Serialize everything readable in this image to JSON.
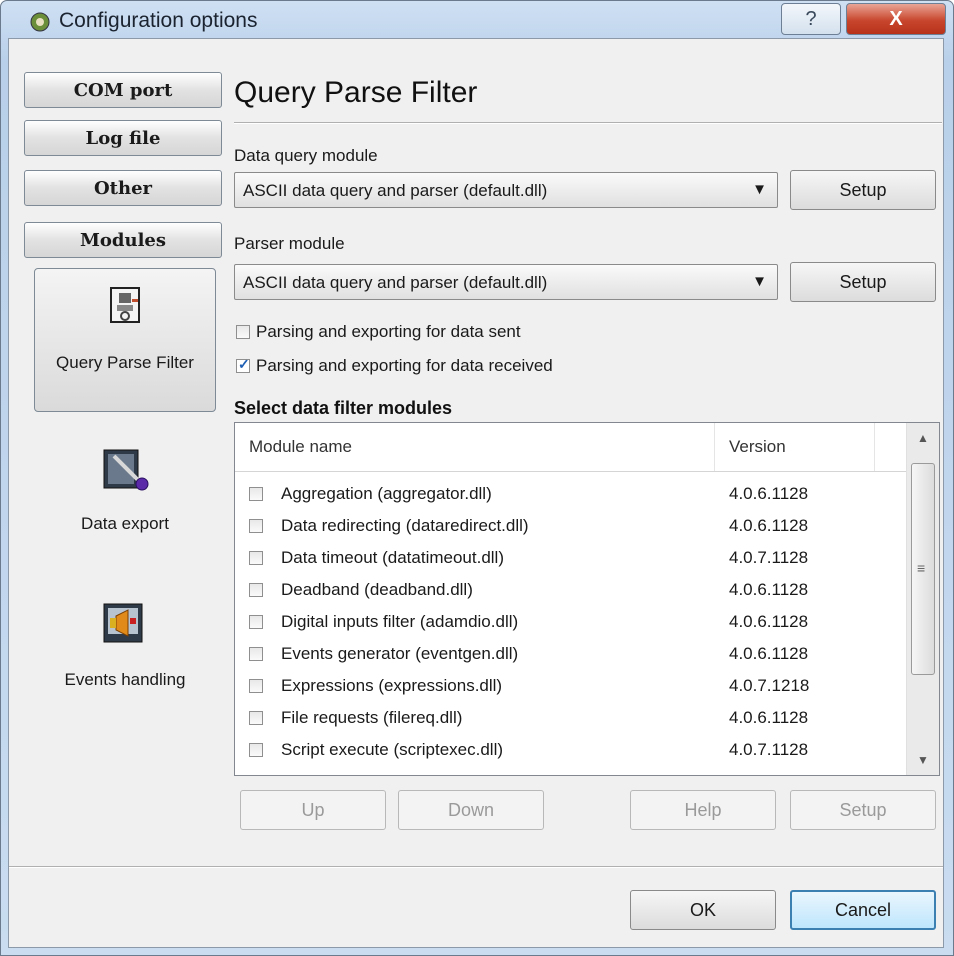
{
  "window": {
    "title": "Configuration options",
    "help_label": "?",
    "close_label": "X"
  },
  "nav_tabs": [
    {
      "label": "COM port"
    },
    {
      "label": "Log file"
    },
    {
      "label": "Other"
    },
    {
      "label": "Modules"
    }
  ],
  "modules_panel": [
    {
      "label": "Query Parse Filter",
      "icon": "plugin-icon",
      "selected": true
    },
    {
      "label": "Data export",
      "icon": "data-export-icon"
    },
    {
      "label": "Events handling",
      "icon": "events-icon"
    }
  ],
  "page": {
    "heading": "Query Parse Filter",
    "data_query_label": "Data query module",
    "data_query_value": "ASCII data query and parser (default.dll)",
    "parser_label": "Parser module",
    "parser_value": "ASCII data query and parser (default.dll)",
    "setup_label": "Setup",
    "check_sent": {
      "label": "Parsing and exporting for data sent",
      "checked": false
    },
    "check_received": {
      "label": "Parsing and exporting for data received",
      "checked": true
    },
    "filter_section": "Select data filter modules"
  },
  "filter_list": {
    "columns": [
      "Module name",
      "Version"
    ],
    "rows": [
      {
        "name": "Aggregation (aggregator.dll)",
        "version": "4.0.6.1128"
      },
      {
        "name": "Data redirecting (dataredirect.dll)",
        "version": "4.0.6.1128"
      },
      {
        "name": "Data timeout (datatimeout.dll)",
        "version": "4.0.7.1128"
      },
      {
        "name": "Deadband (deadband.dll)",
        "version": "4.0.6.1128"
      },
      {
        "name": "Digital inputs filter (adamdio.dll)",
        "version": "4.0.6.1128"
      },
      {
        "name": "Events generator (eventgen.dll)",
        "version": "4.0.6.1128"
      },
      {
        "name": "Expressions (expressions.dll)",
        "version": "4.0.7.1218"
      },
      {
        "name": "File requests (filereq.dll)",
        "version": "4.0.6.1128"
      },
      {
        "name": "Script execute (scriptexec.dll)",
        "version": "4.0.7.1128"
      }
    ]
  },
  "list_buttons": {
    "up": "Up",
    "down": "Down",
    "help": "Help",
    "setup": "Setup"
  },
  "dialog_buttons": {
    "ok": "OK",
    "cancel": "Cancel"
  },
  "colors": {
    "accent": "#3c7fb1",
    "close": "#c8462d",
    "check": "#1f5fb4"
  }
}
